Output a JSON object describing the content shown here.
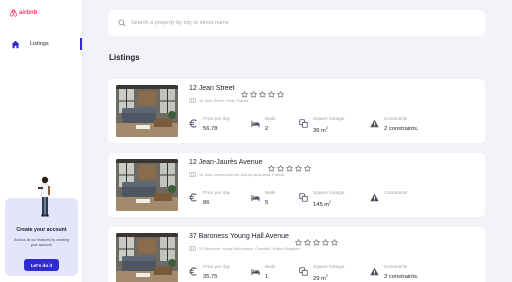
{
  "brand": {
    "name": "airbnb",
    "color": "#ff385c"
  },
  "sidebar": {
    "items": [
      {
        "label": "Listings",
        "icon": "home-icon",
        "active": true
      }
    ],
    "promo": {
      "title": "Create your account",
      "text": "Access all our features by creating your account!",
      "button": "Let's do it"
    }
  },
  "search": {
    "placeholder": "Search a property by city or street name",
    "value": ""
  },
  "main": {
    "title": "Listings"
  },
  "labels": {
    "price": "Price per day",
    "beds": "Beds",
    "sqft": "Square footage",
    "constraints": "Constraints"
  },
  "listings": [
    {
      "title": "12 Jean  Street",
      "address": "12 Jean Street, Paris, France",
      "rating": 0,
      "price": "56.78",
      "beds": "2",
      "sqft": "36 m",
      "sqft_unit": "2",
      "constraints": "2 constraints."
    },
    {
      "title": "12 Jean-Jaurès Avenue",
      "address": "12 Jean-Jaurès Avenue, Aulnay-sous-Bois, France",
      "rating": 0,
      "price": "86",
      "beds": "5",
      "sqft": "145 m",
      "sqft_unit": "2",
      "constraints": ""
    },
    {
      "title": "37 Baroness Young Hall Avenue",
      "address": "37 Baroness Young Hall Avenue, Cranfield, United Kingdom",
      "rating": 0,
      "price": "35.75",
      "beds": "1",
      "sqft": "29 m",
      "sqft_unit": "2",
      "constraints": "3 constraints."
    }
  ],
  "colors": {
    "accent": "#2f2ccf",
    "background": "#f2f3f8",
    "muted": "#a0a2ae",
    "stat_icon": "#4b4d5e"
  }
}
